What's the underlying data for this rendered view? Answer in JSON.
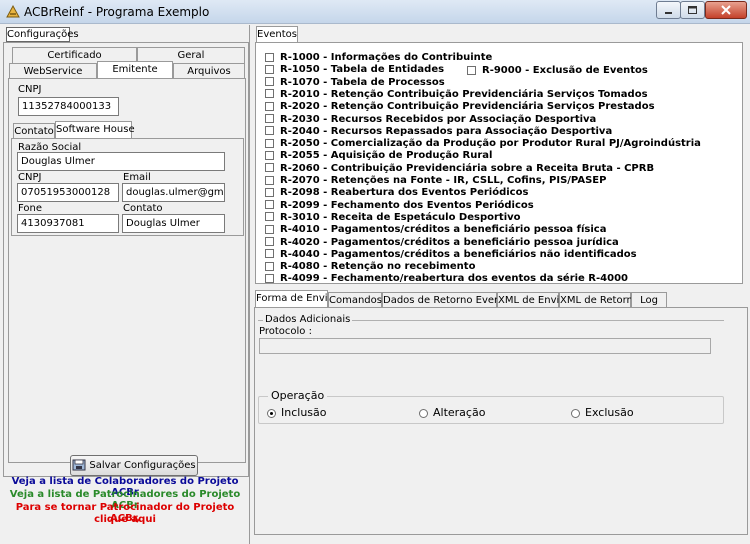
{
  "window": {
    "title": "ACBrReinf - Programa Exemplo"
  },
  "colors": {
    "link_blue": "#0a0a99",
    "link_green": "#2a8a2a",
    "link_red": "#dd0000"
  },
  "left": {
    "group_title": "Configurações",
    "tabs_row1": [
      "Certificado",
      "Geral"
    ],
    "tabs_row2": [
      "WebService",
      "Emitente",
      "Arquivos"
    ],
    "cnpj_label": "CNPJ",
    "cnpj_value": "11352784000133",
    "subtabs": [
      "Contato",
      "Software House"
    ],
    "sh": {
      "razao_label": "Razão Social",
      "razao_value": "Douglas Ulmer",
      "cnpj_label": "CNPJ",
      "cnpj_value": "07051953000128",
      "email_label": "Email",
      "email_value": "douglas.ulmer@gmail.com",
      "fone_label": "Fone",
      "fone_value": "4130937081",
      "contato_label": "Contato",
      "contato_value": "Douglas Ulmer"
    },
    "save_button": "Salvar Configurações",
    "link_colab": "Veja a lista de Colaboradores do Projeto ACBr",
    "link_patroc": "Veja a lista de Patrocinadores do Projeto ACBr",
    "link_tornar_1": "Para se tornar Patrocinador do Projeto ACBr,",
    "link_tornar_2": "clique aqui"
  },
  "eventos": {
    "tab_label": "Eventos",
    "items": [
      "R-1000 - Informações do Contribuinte",
      "R-1050 - Tabela de Entidades",
      "R-1070 - Tabela de Processos",
      "R-2010 - Retenção Contribuição Previdenciária  Serviços Tomados",
      "R-2020 - Retenção Contribuição Previdenciária  Serviços Prestados",
      "R-2030 - Recursos Recebidos por Associação Desportiva",
      "R-2040 - Recursos Repassados para Associação Desportiva",
      "R-2050 - Comercialização da Produção por Produtor Rural PJ/Agroindústria",
      "R-2055 - Aquisição de Produção Rural",
      "R-2060 - Contribuição Previdenciária sobre a Receita Bruta - CPRB",
      "R-2070 - Retenções na Fonte - IR, CSLL, Cofins, PIS/PASEP",
      "R-2098 - Reabertura dos Eventos Periódicos",
      "R-2099 - Fechamento dos Eventos Periódicos",
      "R-3010 - Receita de Espetáculo Desportivo",
      "R-4010 - Pagamentos/créditos a beneficiário pessoa física",
      "R-4020 - Pagamentos/créditos a beneficiário pessoa jurídica",
      "R-4040 - Pagamentos/créditos a beneficiários não identificados",
      "R-4080 - Retenção no recebimento",
      "R-4099 - Fechamento/reabertura dos eventos da série R-4000"
    ],
    "extra": "R-9000 - Exclusão de Eventos"
  },
  "bottom": {
    "tabs": [
      "Forma de Envio",
      "Comandos",
      "Dados de Retorno Eventos",
      "XML de Envio",
      "XML de Retorno",
      "Log"
    ],
    "dados_title": "Dados Adicionais",
    "protocolo_label": "Protocolo :",
    "protocolo_value": "",
    "operacao_title": "Operação",
    "op_inclusao": "Inclusão",
    "op_alteracao": "Alteração",
    "op_exclusao": "Exclusão"
  }
}
